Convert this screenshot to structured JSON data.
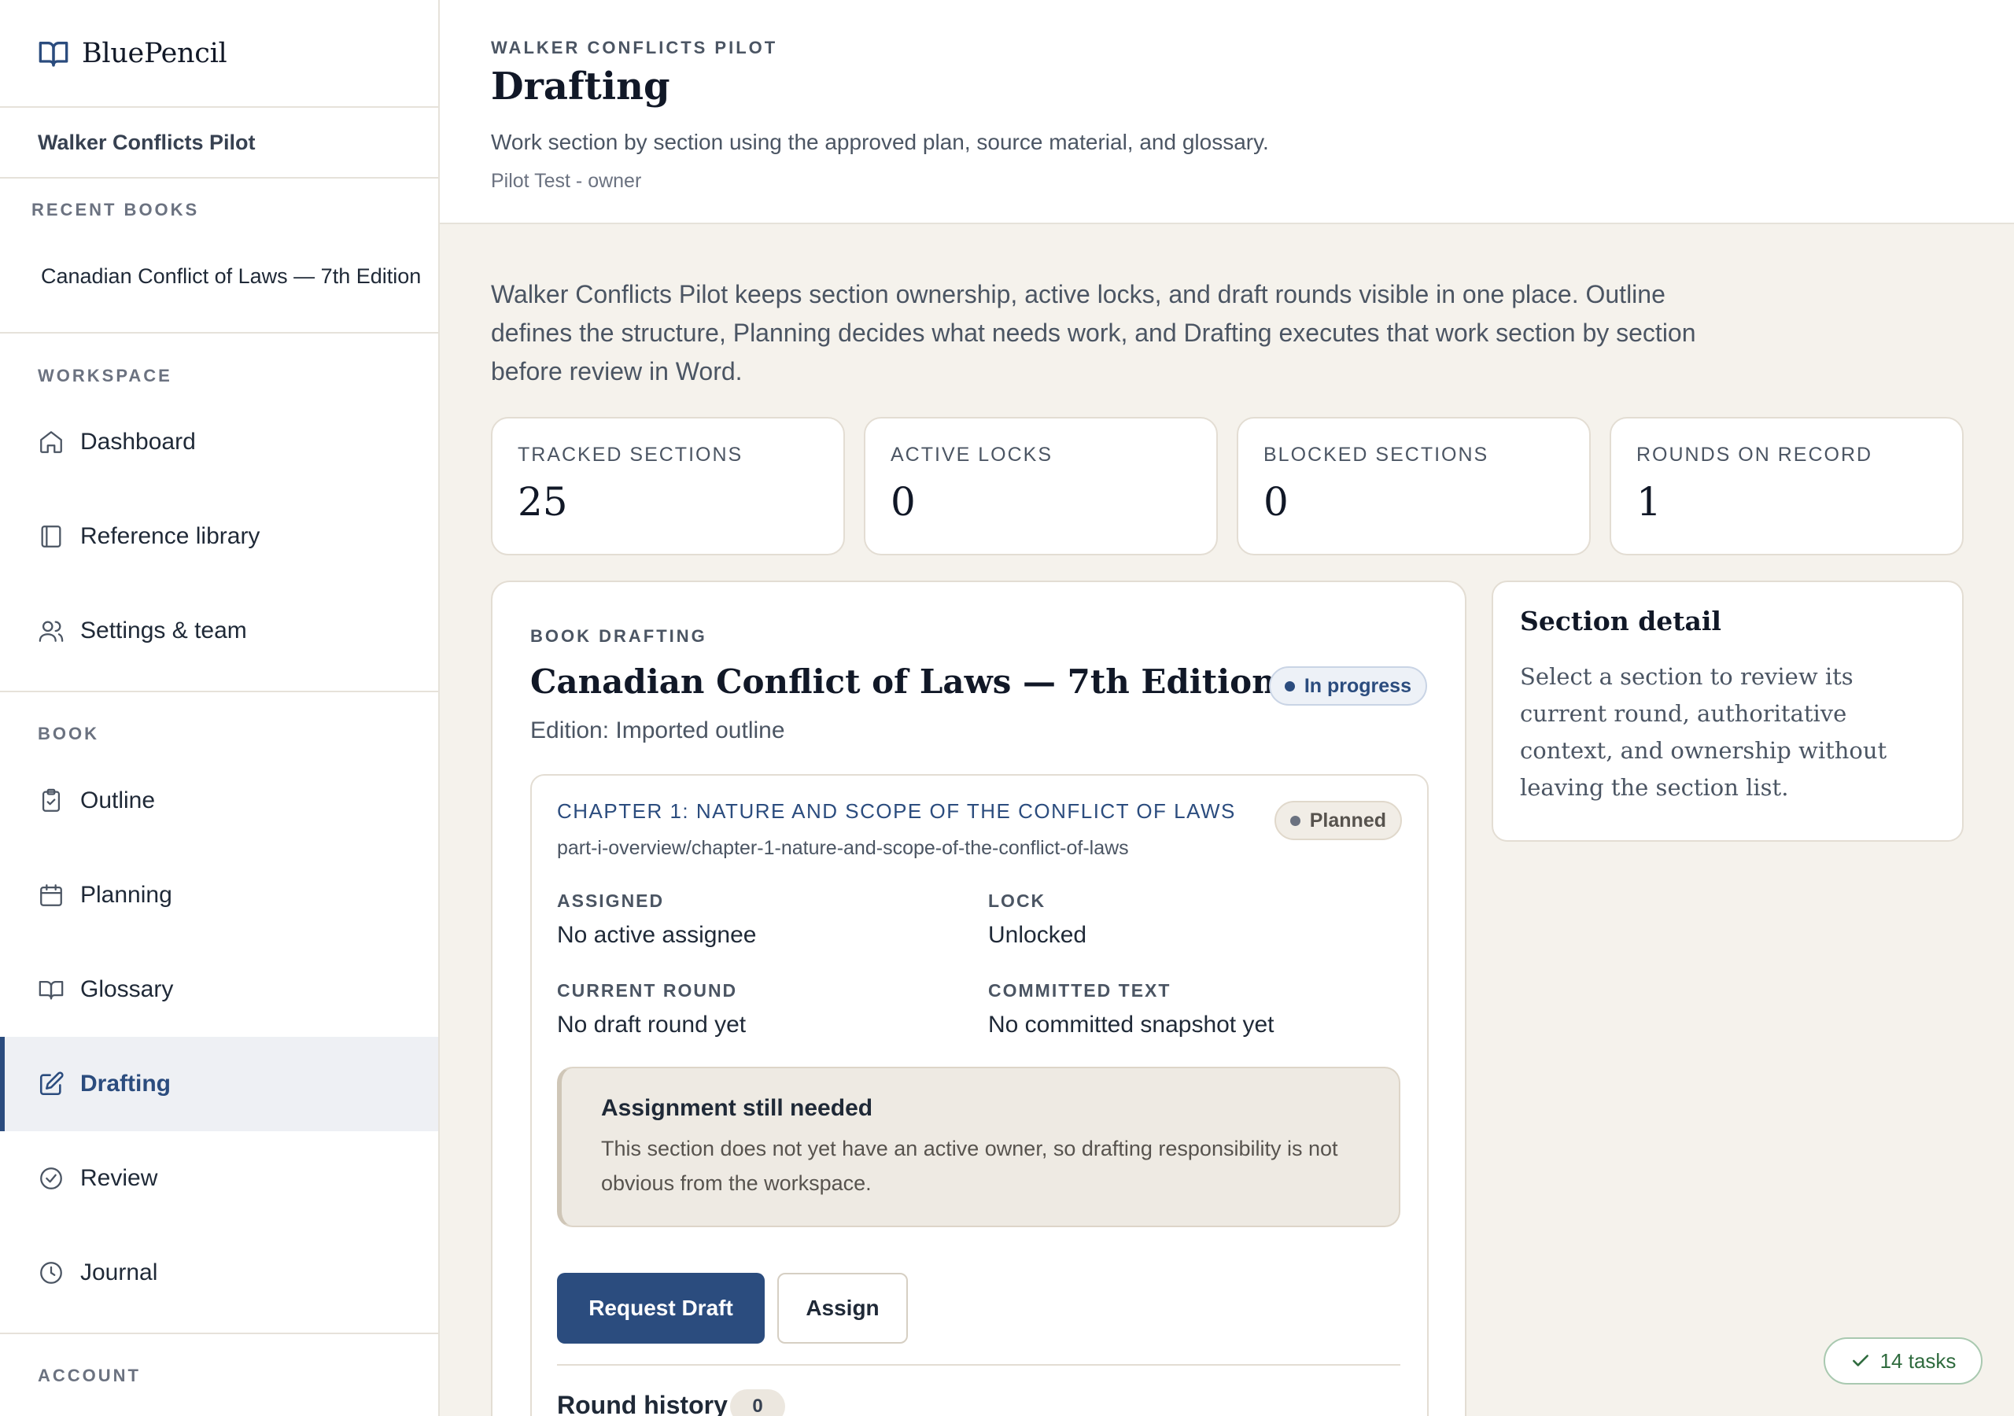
{
  "brand": {
    "name": "BluePencil"
  },
  "sidebar": {
    "project": "Walker Conflicts Pilot",
    "recent_label": "RECENT BOOKS",
    "recent_books": [
      "Canadian Conflict of Laws — 7th Edition"
    ],
    "workspace_label": "WORKSPACE",
    "workspace_items": [
      {
        "label": "Dashboard",
        "icon": "home-icon"
      },
      {
        "label": "Reference library",
        "icon": "book-icon"
      },
      {
        "label": "Settings & team",
        "icon": "users-icon"
      }
    ],
    "book_label": "BOOK",
    "book_items": [
      {
        "label": "Outline",
        "icon": "clipboard-icon"
      },
      {
        "label": "Planning",
        "icon": "calendar-icon"
      },
      {
        "label": "Glossary",
        "icon": "open-book-icon"
      },
      {
        "label": "Drafting",
        "icon": "edit-icon",
        "active": true
      },
      {
        "label": "Review",
        "icon": "check-circle-icon"
      },
      {
        "label": "Journal",
        "icon": "clock-icon"
      }
    ],
    "account_label": "ACCOUNT"
  },
  "header": {
    "eyebrow": "WALKER CONFLICTS PILOT",
    "title": "Drafting",
    "subtitle": "Work section by section using the approved plan, source material, and glossary.",
    "user": "Pilot Test - owner"
  },
  "intro": "Walker Conflicts Pilot keeps section ownership, active locks, and draft rounds visible in one place. Outline defines the structure, Planning decides what needs work, and Drafting executes that work section by section before review in Word.",
  "stats": [
    {
      "label": "TRACKED SECTIONS",
      "value": "25"
    },
    {
      "label": "ACTIVE LOCKS",
      "value": "0"
    },
    {
      "label": "BLOCKED SECTIONS",
      "value": "0"
    },
    {
      "label": "ROUNDS ON RECORD",
      "value": "1"
    }
  ],
  "panel": {
    "eyebrow": "BOOK DRAFTING",
    "title": "Canadian Conflict of Laws — 7th Edition",
    "edition": "Edition: Imported outline",
    "status": "In progress",
    "chapter": {
      "title": "CHAPTER 1: NATURE AND SCOPE OF THE CONFLICT OF LAWS",
      "path": "part-i-overview/chapter-1-nature-and-scope-of-the-conflict-of-laws",
      "status": "Planned",
      "assigned_label": "ASSIGNED",
      "assigned_value": "No active assignee",
      "lock_label": "LOCK",
      "lock_value": "Unlocked",
      "round_label": "CURRENT ROUND",
      "round_value": "No draft round yet",
      "committed_label": "COMMITTED TEXT",
      "committed_value": "No committed snapshot yet",
      "notice_title": "Assignment still needed",
      "notice_text": "This section does not yet have an active owner, so drafting responsibility is not obvious from the workspace.",
      "request_button": "Request Draft",
      "assign_button": "Assign",
      "history_title": "Round history",
      "history_count": "0"
    }
  },
  "detail": {
    "title": "Section detail",
    "text": "Select a section to review its current round, authoritative context, and ownership without leaving the section list."
  },
  "tasks": {
    "label": "14 tasks"
  },
  "colors": {
    "accent": "#2b4c7e",
    "background": "#f5f2ec",
    "success": "#2f6b3e"
  }
}
